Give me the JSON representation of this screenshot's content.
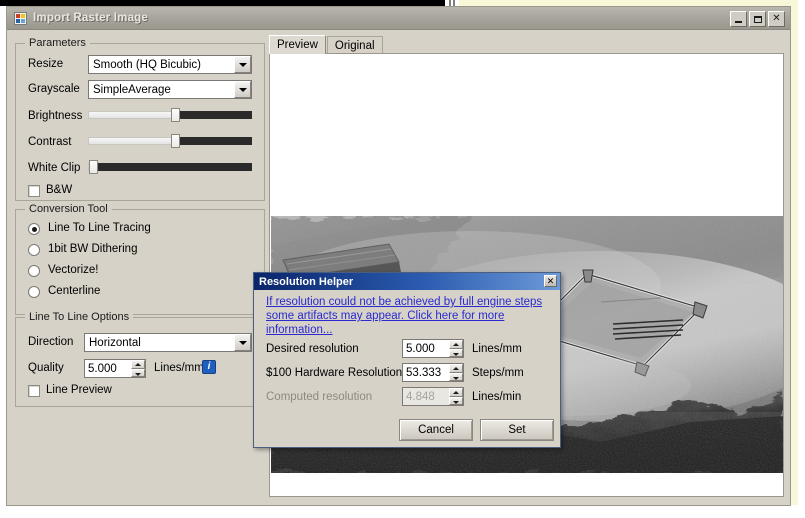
{
  "window": {
    "title": "Import Raster Image",
    "icon": "form-icon",
    "buttons": {
      "minimize": "minimize-icon",
      "maximize": "maximize-icon",
      "close": "✕"
    }
  },
  "parameters": {
    "group_label": "Parameters",
    "resize": {
      "label": "Resize",
      "value": "Smooth (HQ Bicubic)"
    },
    "grayscale": {
      "label": "Grayscale",
      "value": "SimpleAverage"
    },
    "brightness": {
      "label": "Brightness",
      "percent": 52
    },
    "contrast": {
      "label": "Contrast",
      "percent": 52
    },
    "white_clip": {
      "label": "White Clip",
      "percent": 3
    },
    "bw": {
      "label": "B&W",
      "checked": false
    }
  },
  "conversion_tool": {
    "group_label": "Conversion Tool",
    "options": [
      {
        "label": "Line To Line Tracing",
        "selected": true
      },
      {
        "label": "1bit BW Dithering",
        "selected": false
      },
      {
        "label": "Vectorize!",
        "selected": false
      },
      {
        "label": "Centerline",
        "selected": false
      }
    ]
  },
  "line_options": {
    "group_label": "Line To Line Options",
    "direction": {
      "label": "Direction",
      "value": "Horizontal"
    },
    "quality": {
      "label": "Quality",
      "value": "5.000",
      "unit": "Lines/mm",
      "info": "i"
    },
    "line_preview": {
      "label": "Line Preview",
      "checked": false
    }
  },
  "preview": {
    "tabs": [
      {
        "label": "Preview",
        "active": true
      },
      {
        "label": "Original",
        "active": false
      }
    ],
    "image_description": "grayscale-photo-misty-cliff-with-structure"
  },
  "dialog": {
    "title": "Resolution Helper",
    "close_glyph": "✕",
    "warning_link": "If resolution could not be achieved by full engine steps some artifacts may appear. Click here for more information...",
    "rows": [
      {
        "label": "Desired resolution",
        "value": "5.000",
        "unit": "Lines/mm",
        "disabled": false
      },
      {
        "label": "$100 Hardware Resolution",
        "value": "53.333",
        "unit": "Steps/mm",
        "disabled": false
      },
      {
        "label": "Computed resolution",
        "value": "4.848",
        "unit": "Lines/min",
        "disabled": true
      }
    ],
    "cancel_label": "Cancel",
    "set_label": "Set"
  },
  "colors": {
    "window_face": "#d6d2c8",
    "title_gradient_start": "#b9b6ae",
    "dialog_title_start": "#0a246a",
    "dialog_title_end": "#6d9ad8",
    "link": "#2a2ad0",
    "info_badge": "#1f5fbf",
    "desktop_cream": "#f9f7d8"
  }
}
